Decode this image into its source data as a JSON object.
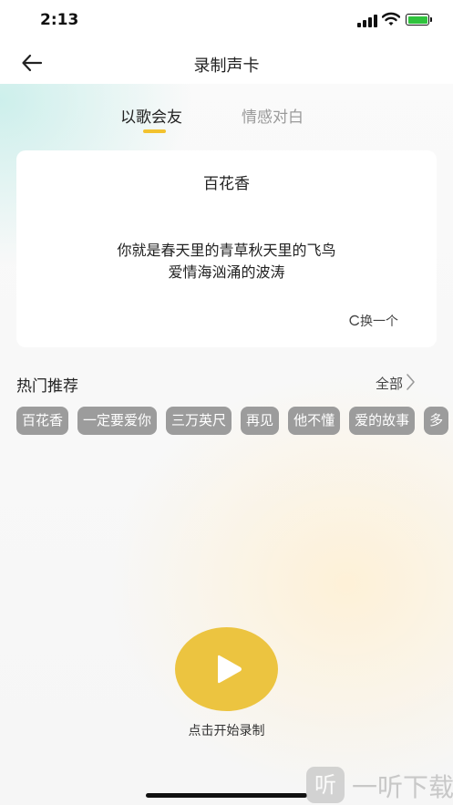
{
  "status": {
    "time": "2:13"
  },
  "nav": {
    "title": "录制声卡"
  },
  "tabs": [
    {
      "label": "以歌会友",
      "active": true
    },
    {
      "label": "情感对白",
      "active": false
    }
  ],
  "card": {
    "title": "百花香",
    "lyrics": [
      "你就是春天里的青草秋天里的飞鸟",
      "爱情海汹涌的波涛"
    ],
    "swap_label": "换一个"
  },
  "hot": {
    "title": "热门推荐",
    "see_all": "全部",
    "chips": [
      "百花香",
      "一定要爱你",
      "三万英尺",
      "再见",
      "他不懂",
      "爱的故事",
      "多"
    ]
  },
  "record": {
    "label": "点击开始录制"
  },
  "watermark": {
    "icon_text": "听",
    "text": "一听下载"
  },
  "colors": {
    "accent": "#f2c22f",
    "record": "#ecc440",
    "chip": "#9c9c9c",
    "battery": "#2fc33d"
  }
}
